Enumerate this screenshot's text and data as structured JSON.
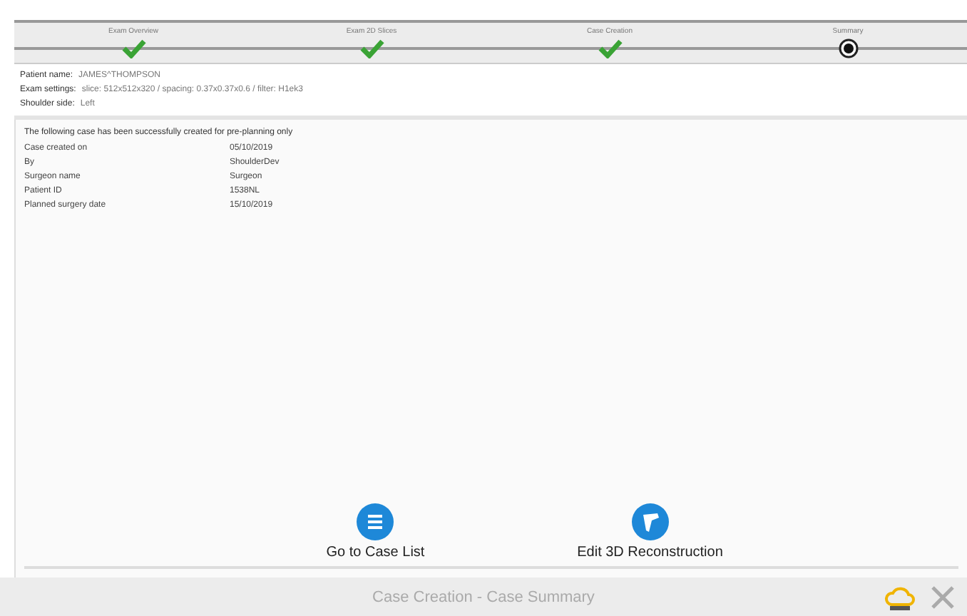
{
  "steps": [
    {
      "label": "Exam Overview",
      "kind": "done"
    },
    {
      "label": "Exam 2D Slices",
      "kind": "done"
    },
    {
      "label": "Case Creation",
      "kind": "done"
    },
    {
      "label": "Summary",
      "kind": "current"
    }
  ],
  "patient_info": [
    {
      "label": "Patient name:",
      "value": "JAMES^THOMPSON"
    },
    {
      "label": "Exam settings:",
      "value": "slice: 512x512x320 / spacing: 0.37x0.37x0.6 / filter: H1ek3"
    },
    {
      "label": "Shoulder side:",
      "value": "Left"
    }
  ],
  "summary": {
    "intro": "The following case has been successfully created for pre-planning only",
    "rows": [
      {
        "label": "Case created on",
        "value": "05/10/2019"
      },
      {
        "label": "By",
        "value": "ShoulderDev"
      },
      {
        "label": "Surgeon name",
        "value": "Surgeon"
      },
      {
        "label": "Patient ID",
        "value": "1538NL"
      },
      {
        "label": "Planned surgery date",
        "value": "15/10/2019"
      }
    ]
  },
  "actions": [
    {
      "label": "Go to Case List",
      "kind": "list"
    },
    {
      "label": "Edit 3D Reconstruction",
      "kind": "edit"
    }
  ],
  "footer": {
    "title": "Case Creation - Case Summary"
  }
}
